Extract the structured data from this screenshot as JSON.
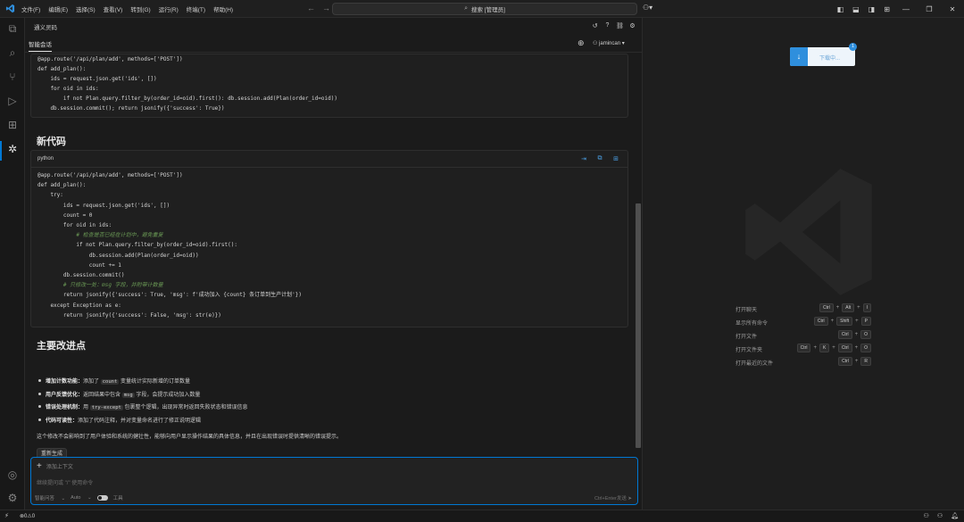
{
  "titlebar": {
    "menus": [
      "文件(F)",
      "编辑(E)",
      "选择(S)",
      "查看(V)",
      "转到(G)",
      "运行(R)",
      "终端(T)",
      "帮助(H)"
    ],
    "search_text": "搜索 [管理员]"
  },
  "activity_icons": [
    "files-icon",
    "search-icon",
    "source-control-icon",
    "run-debug-icon",
    "extensions-icon",
    "ai-chat-icon"
  ],
  "chat": {
    "panel_title": "通义灵码",
    "tab_label": "智能会话",
    "user_name": "jamincan",
    "old_code": [
      "@app.route('/api/plan/add', methods=['POST'])",
      "def add_plan():",
      "    ids = request.json.get('ids', [])",
      "    for oid in ids:",
      "        if not Plan.query.filter_by(order_id=oid).first(): db.session.add(Plan(order_id=oid))",
      "    db.session.commit(); return jsonify({'success': True})"
    ],
    "new_code_heading": "新代码",
    "lang_label": "python",
    "new_code": [
      {
        "t": "@app.route('/api/plan/add', methods=['POST'])",
        "c": false
      },
      {
        "t": "def add_plan():",
        "c": false
      },
      {
        "t": "    try:",
        "c": false
      },
      {
        "t": "        ids = request.json.get('ids', [])",
        "c": false
      },
      {
        "t": "        count = 0",
        "c": false
      },
      {
        "t": "        for oid in ids:",
        "c": false
      },
      {
        "t": "            # 检查是否已经在计划中，避免重复",
        "c": true
      },
      {
        "t": "            if not Plan.query.filter_by(order_id=oid).first():",
        "c": false
      },
      {
        "t": "                db.session.add(Plan(order_id=oid))",
        "c": false
      },
      {
        "t": "                count += 1",
        "c": false
      },
      {
        "t": "        db.session.commit()",
        "c": false
      },
      {
        "t": "        # 只修改一处：msg 字段，并附带计数量",
        "c": true
      },
      {
        "t": "        return jsonify({'success': True, 'msg': f'成功加入 {count} 条订单到生产计划'})",
        "c": false
      },
      {
        "t": "    except Exception as e:",
        "c": false
      },
      {
        "t": "        return jsonify({'success': False, 'msg': str(e)})",
        "c": false
      }
    ],
    "improvements_heading": "主要改进点",
    "improvements": [
      {
        "title": "增加计数功能：",
        "pre": "添加了",
        "code": "count",
        "post": "变量统计实际新增的订单数量"
      },
      {
        "title": "用户反馈优化：",
        "pre": "返回结果中包含",
        "code": "msg",
        "post": "字段，会提示成功加入数量"
      },
      {
        "title": "错误处理机制：",
        "pre": "用",
        "code": "try-except",
        "post": "包裹整个逻辑，出现异常时返回失败状态和错误信息"
      },
      {
        "title": "代码可读性：",
        "pre": "添加了代码注释，并对变量命名进行了修正说明逻辑",
        "code": "",
        "post": ""
      }
    ],
    "summary": "这个修改不会影响到了用户体验和系统的健壮性，能够向用户显示操作结果的具体信息，并且在出现错误时提供清晰的错误提示。",
    "regen_label": "重新生成",
    "input": {
      "context_label": "添加上下文",
      "placeholder": "继续提问或 \"/\" 使用命令",
      "mode_label": "智能问答",
      "model_label": "Auto",
      "tools_label": "工具",
      "send_hint": "Ctrl+Enter发送"
    }
  },
  "editor": {
    "download_label": "下载中...",
    "download_badge": "1",
    "shortcuts": [
      {
        "label": "打开聊天",
        "keys": [
          "Ctrl",
          "Alt",
          "I"
        ]
      },
      {
        "label": "显示所有命令",
        "keys": [
          "Ctrl",
          "Shift",
          "P"
        ]
      },
      {
        "label": "打开文件",
        "keys": [
          "Ctrl",
          "O"
        ]
      },
      {
        "label": "打开文件夹",
        "keys": [
          "Ctrl",
          "K",
          "Ctrl",
          "O"
        ]
      },
      {
        "label": "打开最近的文件",
        "keys": [
          "Ctrl",
          "R"
        ]
      }
    ]
  },
  "statusbar": {
    "problems": "⊗0⚠0"
  },
  "colors": {
    "accent": "#0078d4",
    "comment": "#6a9955",
    "code_action": "#4a9de0"
  }
}
